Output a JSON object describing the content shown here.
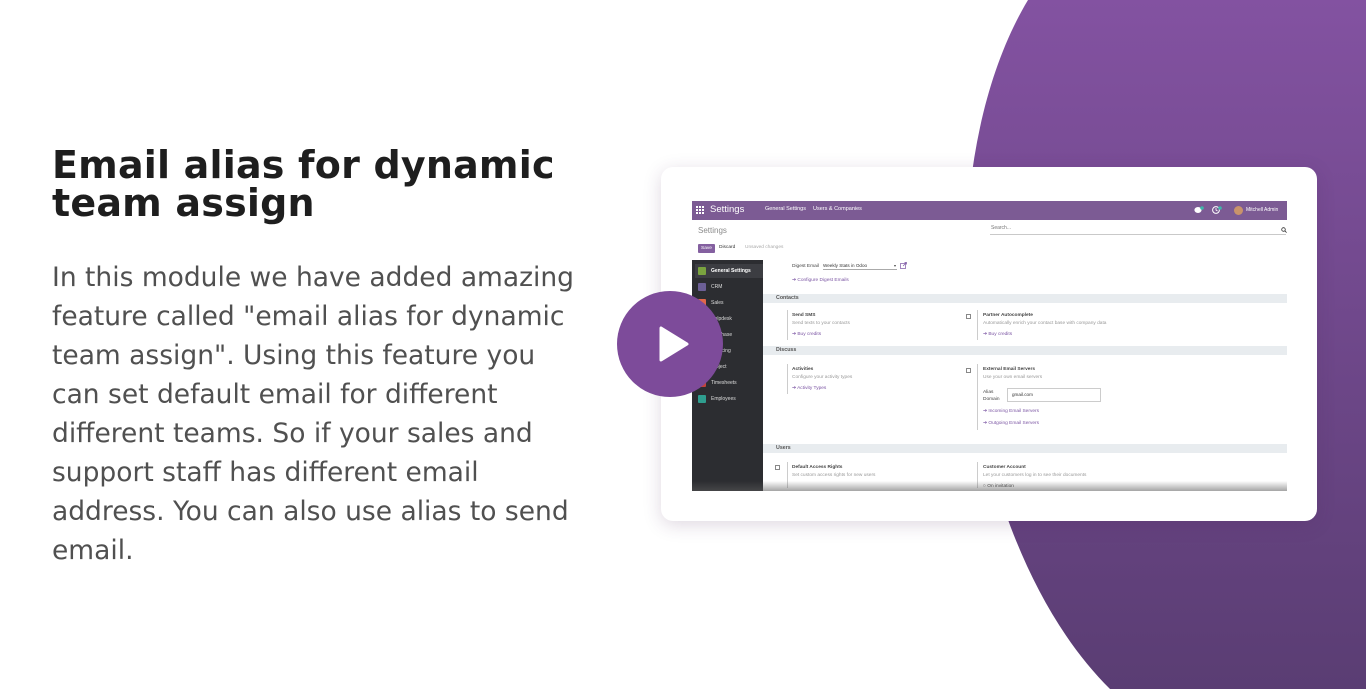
{
  "colors": {
    "accent": "#7d4b9a",
    "odoo_purple": "#7c5b94",
    "link": "#7b55a3"
  },
  "headline": [
    "Email alias for dynamic",
    "team assign"
  ],
  "description": [
    "In this module we have added amazing",
    "feature called \"email alias for dynamic",
    "team assign\". Using this feature you",
    "can set default email for different",
    "different teams. So if your sales and",
    "support staff has different email",
    "address. You can also use alias to send",
    "email."
  ],
  "video": {
    "icon": "play-icon"
  },
  "odoo": {
    "topbar": {
      "brand": "Settings",
      "menu": [
        "General Settings",
        "Users & Companies"
      ],
      "user": "Mitchell Admin",
      "icons": [
        "apps-grid-icon",
        "chat-icon",
        "activity-clock-icon"
      ]
    },
    "control_panel": {
      "title": "Settings",
      "search_placeholder": "Search...",
      "save_label": "Save",
      "discard_label": "Discard",
      "unsaved_label": "Unsaved changes"
    },
    "sidebar": [
      {
        "label": "General Settings",
        "color": "#7aa33f",
        "active": true
      },
      {
        "label": "CRM",
        "color": "#6c5f96"
      },
      {
        "label": "Sales",
        "color": "#e0674a"
      },
      {
        "label": "Helpdesk",
        "color": "#3f8f8f"
      },
      {
        "label": "Purchase",
        "color": "#9d6b9b"
      },
      {
        "label": "Invoicing",
        "color": "#2d8ec4"
      },
      {
        "label": "Project",
        "color": "#d39032"
      },
      {
        "label": "Timesheets",
        "color": "#c4433a"
      },
      {
        "label": "Employees",
        "color": "#2f9e8f"
      }
    ],
    "digest": {
      "label": "Digest Email",
      "value": "Weekly Stats in Odoo",
      "link": "Configure Digest Emails"
    },
    "sections": {
      "contacts": "Contacts",
      "discuss": "Discuss",
      "users": "Users"
    },
    "contacts": {
      "send_sms": {
        "title": "Send SMS",
        "desc": "Send texts to your contacts",
        "link": "Buy credits"
      },
      "partner_autocomplete": {
        "title": "Partner Autocomplete",
        "desc": "Automatically enrich your contact base with company data",
        "link": "Buy credits"
      }
    },
    "discuss": {
      "activities": {
        "title": "Activities",
        "desc": "Configure your activity types",
        "link": "Activity Types"
      },
      "external_email": {
        "title": "External Email Servers",
        "desc": "Use your own email servers",
        "alias_label": "Alias",
        "domain_label": "Domain",
        "alias_value": "gmail.com",
        "link_incoming": "Incoming Email Servers",
        "link_outgoing": "Outgoing Email Servers"
      }
    },
    "users": {
      "access_rights": {
        "title": "Default Access Rights",
        "desc": "Set custom access rights for new users"
      },
      "customer_account": {
        "title": "Customer Account",
        "desc": "Let your customers log in to see their documents",
        "option": "On invitation"
      }
    }
  }
}
